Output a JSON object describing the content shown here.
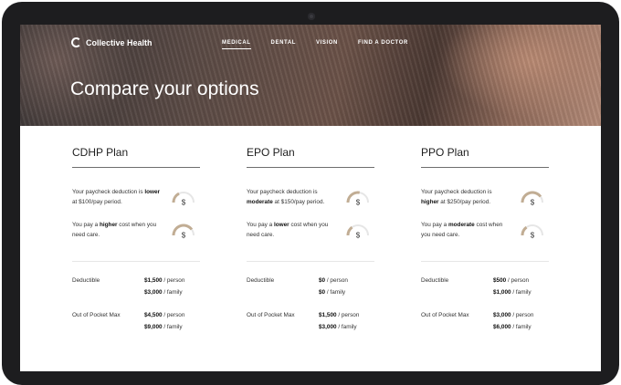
{
  "brand": {
    "name": "Collective Health"
  },
  "nav": [
    {
      "label": "MEDICAL",
      "active": true
    },
    {
      "label": "DENTAL",
      "active": false
    },
    {
      "label": "VISION",
      "active": false
    },
    {
      "label": "FIND A DOCTOR",
      "active": false
    }
  ],
  "hero": {
    "title": "Compare your options"
  },
  "colors": {
    "gauge_fill": "#c1ad94",
    "gauge_track": "#e6e6e6"
  },
  "plans": [
    {
      "name": "CDHP Plan",
      "deduction": {
        "pre": "Your paycheck deduction is ",
        "level": "lower",
        "post": " at $100/pay period.",
        "gauge_level": 0.35
      },
      "cost": {
        "pre": "You pay a ",
        "level": "higher",
        "post": " cost when you need care.",
        "gauge_level": 0.8
      },
      "deductible_label": "Deductible",
      "deductible_person": "$1,500",
      "deductible_person_unit": " / person",
      "deductible_family": "$3,000",
      "deductible_family_unit": " / family",
      "oop_label": "Out of Pocket Max",
      "oop_person": "$4,500",
      "oop_person_unit": " / person",
      "oop_family": "$9,000",
      "oop_family_unit": " / family"
    },
    {
      "name": "EPO Plan",
      "deduction": {
        "pre": "Your paycheck deduction is ",
        "level": "moderate",
        "post": " at $150/pay period.",
        "gauge_level": 0.55
      },
      "cost": {
        "pre": "You pay a ",
        "level": "lower",
        "post": " cost when you need care.",
        "gauge_level": 0.3
      },
      "deductible_label": "Deductible",
      "deductible_person": "$0",
      "deductible_person_unit": " / person",
      "deductible_family": "$0",
      "deductible_family_unit": " / family",
      "oop_label": "Out of Pocket Max",
      "oop_person": "$1,500",
      "oop_person_unit": " / person",
      "oop_family": "$3,000",
      "oop_family_unit": " / family"
    },
    {
      "name": "PPO Plan",
      "deduction": {
        "pre": "Your paycheck deduction is ",
        "level": "higher",
        "post": " at $250/pay period.",
        "gauge_level": 0.8
      },
      "cost": {
        "pre": "You pay a ",
        "level": "moderate",
        "post": " cost when you need care.",
        "gauge_level": 0.3
      },
      "deductible_label": "Deductible",
      "deductible_person": "$500",
      "deductible_person_unit": " / person",
      "deductible_family": "$1,000",
      "deductible_family_unit": " / family",
      "oop_label": "Out of Pocket Max",
      "oop_person": "$3,000",
      "oop_person_unit": " / person",
      "oop_family": "$6,000",
      "oop_family_unit": " / family"
    }
  ]
}
